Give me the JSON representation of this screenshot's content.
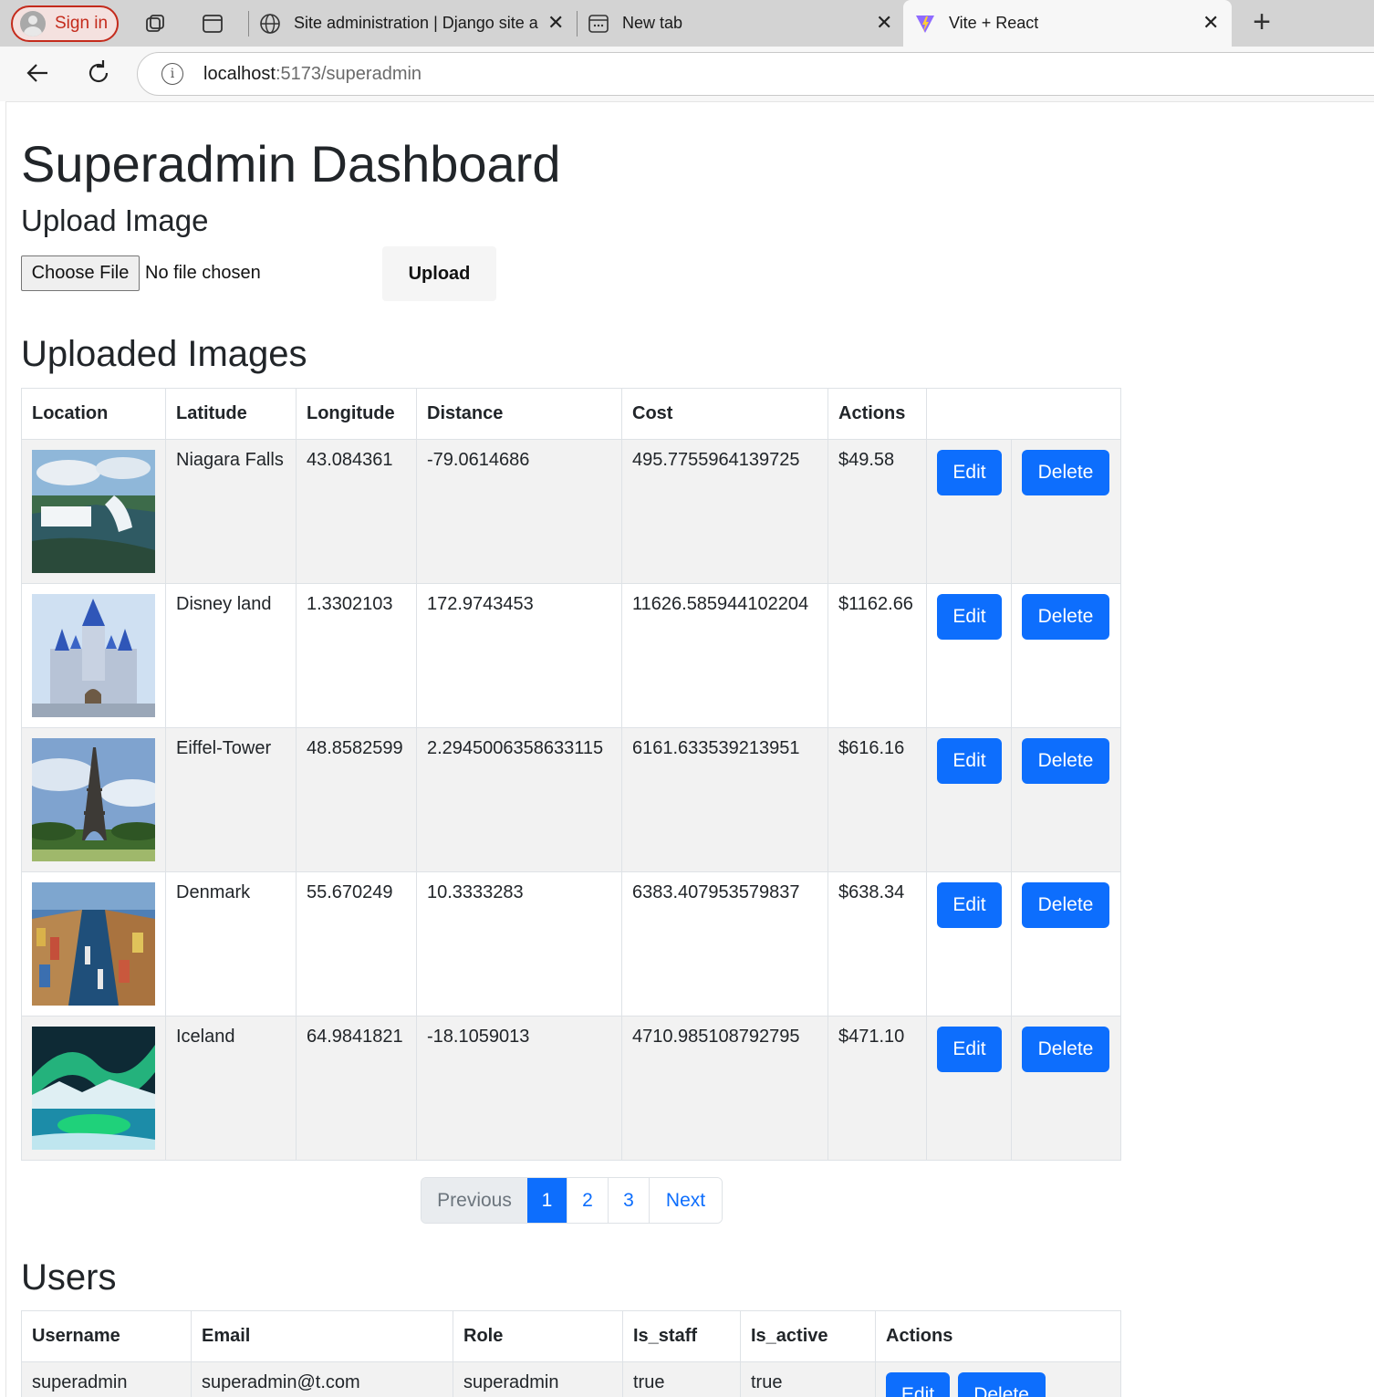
{
  "browser": {
    "signin_label": "Sign in",
    "tabs": [
      {
        "title": "Site administration | Django site a",
        "icon": "globe-icon"
      },
      {
        "title": "New tab",
        "icon": "newtab-icon"
      },
      {
        "title": "Vite + React",
        "icon": "vite-icon",
        "active": true
      }
    ],
    "url_host": "localhost",
    "url_path": ":5173/superadmin"
  },
  "page": {
    "title": "Superadmin Dashboard",
    "upload": {
      "heading": "Upload Image",
      "choose_file_label": "Choose File",
      "file_status": "No file chosen",
      "upload_button": "Upload"
    },
    "images_section": {
      "heading": "Uploaded Images",
      "columns": [
        "Location",
        "Latitude",
        "Longitude",
        "Distance",
        "Cost",
        "Actions"
      ],
      "rows": [
        {
          "name": "Niagara Falls",
          "latitude": "43.084361",
          "longitude": "-79.0614686",
          "distance": "495.7755964139725",
          "cost": "$49.58",
          "thumb": "waterfall"
        },
        {
          "name": "Disney land",
          "latitude": "1.3302103",
          "longitude": "172.9743453",
          "distance": "11626.585944102204",
          "cost": "$1162.66",
          "thumb": "castle"
        },
        {
          "name": "Eiffel-Tower",
          "latitude": "48.8582599",
          "longitude": "2.2945006358633115",
          "distance": "6161.633539213951",
          "cost": "$616.16",
          "thumb": "tower"
        },
        {
          "name": "Denmark",
          "latitude": "55.670249",
          "longitude": "10.3333283",
          "distance": "6383.407953579837",
          "cost": "$638.34",
          "thumb": "harbor"
        },
        {
          "name": "Iceland",
          "latitude": "64.9841821",
          "longitude": "-18.1059013",
          "distance": "4710.985108792795",
          "cost": "$471.10",
          "thumb": "aurora"
        }
      ],
      "edit_label": "Edit",
      "delete_label": "Delete"
    },
    "pagination": {
      "previous": "Previous",
      "pages": [
        "1",
        "2",
        "3"
      ],
      "current_page": "1",
      "next": "Next"
    },
    "users_section": {
      "heading": "Users",
      "columns": [
        "Username",
        "Email",
        "Role",
        "Is_staff",
        "Is_active",
        "Actions"
      ],
      "rows": [
        {
          "username": "superadmin",
          "email": "superadmin@t.com",
          "role": "superadmin",
          "is_staff": "true",
          "is_active": "true"
        }
      ],
      "edit_label": "Edit",
      "delete_label": "Delete"
    }
  },
  "colors": {
    "primary": "#0d6efd",
    "stripe": "#f2f2f2",
    "signin_red": "#c42b1c"
  }
}
